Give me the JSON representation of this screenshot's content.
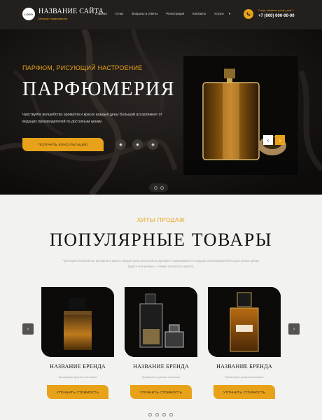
{
  "header": {
    "logo": "LOGO",
    "site_title": "НАЗВАНИЕ САЙТА",
    "site_subtitle": "Магазин парфюмерии",
    "nav": [
      "Главная",
      "О нас",
      "Вопросы и ответы",
      "Регистрация",
      "Контакты",
      "Услуги"
    ],
    "address": "Город, название улицы, дом 1",
    "phone": "+7 (000) 000-00-00"
  },
  "hero": {
    "kicker": "ПАРФЮМ, РИСУЮЩИЙ НАСТРОЕНИЕ",
    "title": "ПАРФЮМЕРИЯ",
    "text": "Чувствуйте волшебство ароматов и красок каждый день! Большой ассортимент от ведущих производителей по доступным ценам",
    "button": "ПОЛУЧИТЬ КОНСУЛЬТАЦИЮ",
    "socials": [
      "vk-icon",
      "telegram-icon",
      "send-icon"
    ]
  },
  "products": {
    "kicker": "ХИТЫ ПРОДАЖ",
    "title": "ПОПУЛЯРНЫЕ ТОВАРЫ",
    "text": "Чувствуйте волшебство ароматов и красок каждый день! Большой ассортимент парфюмерии от ведущих производителей по доступным ценам. Будьте неотразимы – в мире ароматов и красок.",
    "items": [
      {
        "brand": "НАЗВАНИЕ БРЕНДА",
        "desc": "Примерное краткое описание",
        "button": "УТОЧНИТЬ СТОИМОСТЬ"
      },
      {
        "brand": "НАЗВАНИЕ БРЕНДА",
        "desc": "Примерное краткое описание",
        "button": "УТОЧНИТЬ СТОИМОСТЬ"
      },
      {
        "brand": "НАЗВАНИЕ БРЕНДА",
        "desc": "Примерное краткое описание",
        "button": "УТОЧНИТЬ СТОИМОСТЬ"
      }
    ]
  },
  "colors": {
    "accent": "#e8a21a",
    "dark": "#231f1c"
  }
}
